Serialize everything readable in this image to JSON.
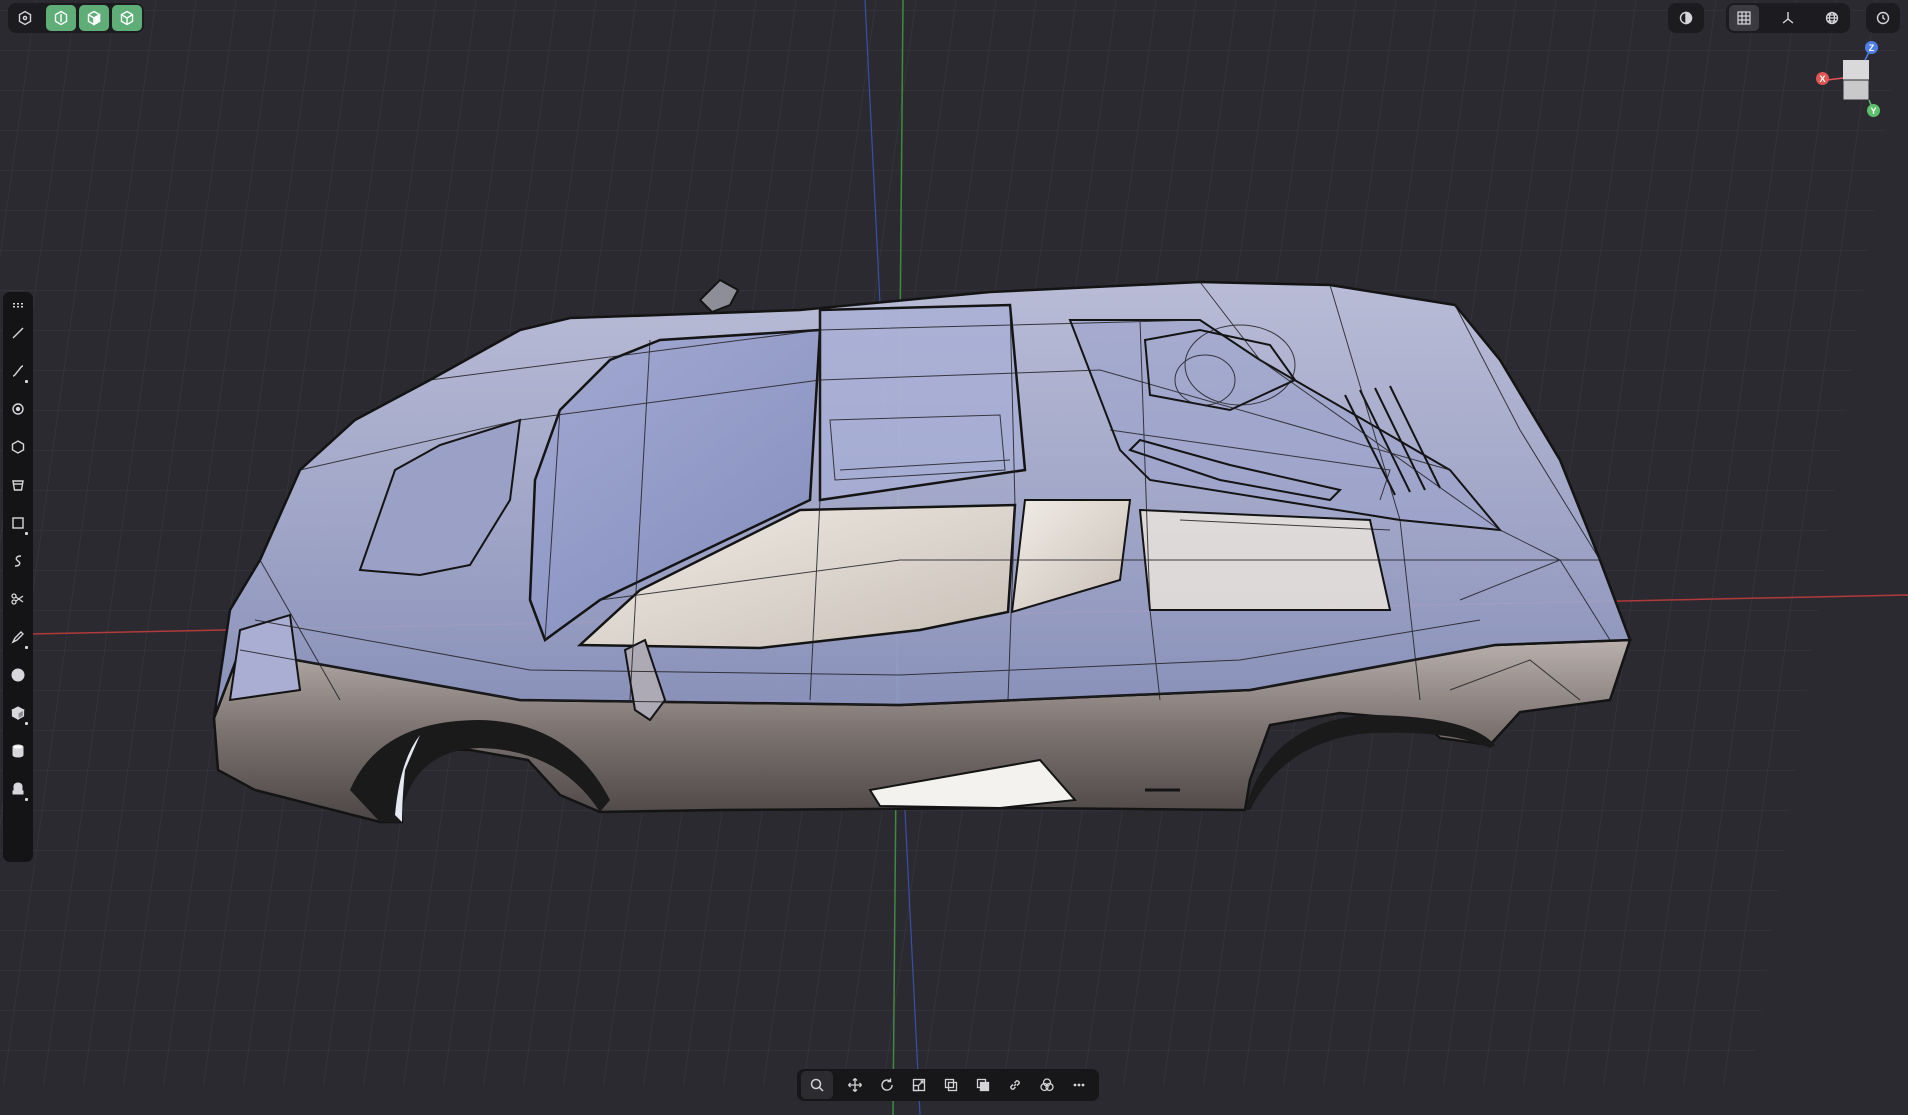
{
  "app": {
    "accent_color": "#5fae78",
    "background_color": "#2a2a30"
  },
  "top_left": {
    "menu_icon": "hexagon-icon",
    "view_modes": [
      {
        "name": "solid-view-icon",
        "active": true
      },
      {
        "name": "shaded-view-icon",
        "active": true
      },
      {
        "name": "wireframe-view-icon",
        "active": true
      }
    ]
  },
  "top_right": {
    "items": [
      "contrast-icon",
      "grid-icon",
      "axes-icon",
      "globe-icon",
      "clock-icon"
    ]
  },
  "nav_gizmo": {
    "z_label": "Z",
    "x_label": "X",
    "y_label": "Y",
    "colors": {
      "x": "#e25555",
      "y": "#5cc06b",
      "z": "#4f7fe6"
    }
  },
  "left_toolbar": {
    "tools": [
      "grip-icon",
      "line-icon",
      "curve-icon",
      "circle-icon",
      "polygon-icon",
      "bucket-icon",
      "rectangle-icon",
      "spline-icon",
      "scissors-icon",
      "pen-icon",
      "sphere-icon",
      "cube-icon",
      "cylinder-icon",
      "stamp-icon"
    ]
  },
  "bottom_toolbar": {
    "tools": [
      "search-icon",
      "move-icon",
      "rotate-icon",
      "scale-icon",
      "duplicate-icon",
      "layers-icon",
      "link-icon",
      "boolean-icon",
      "more-icon"
    ]
  }
}
